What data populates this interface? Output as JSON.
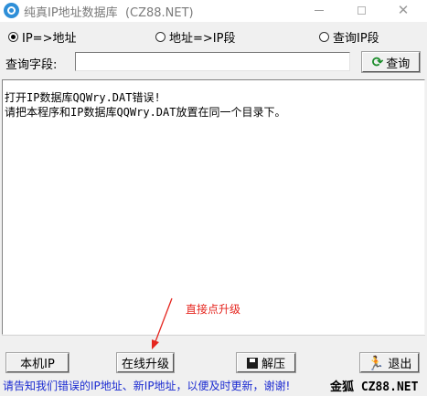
{
  "window": {
    "title": "纯真IP地址数据库  (CZ88.NET)",
    "icons": {
      "app": "app-logo-icon",
      "minimize": "minimize-icon",
      "maximize": "maximize-icon",
      "close": "close-icon"
    },
    "close_glyph": "✕"
  },
  "mode": {
    "options": [
      {
        "label": "IP=>地址",
        "selected": true
      },
      {
        "label": "地址=>IP段",
        "selected": false
      },
      {
        "label": "查询IP段",
        "selected": false
      }
    ]
  },
  "query": {
    "label": "查询字段:",
    "value": "",
    "button_label": "查询",
    "button_icon": "refresh-icon",
    "button_icon_glyph": "⟳"
  },
  "result": {
    "lines": [
      "打开IP数据库QQWry.DAT错误!",
      "请把本程序和IP数据库QQWry.DAT放置在同一个目录下。"
    ]
  },
  "annotation": {
    "text": "直接点升级",
    "color": "#e5261f"
  },
  "buttons": {
    "local_ip": "本机IP",
    "upgrade": "在线升级",
    "extract": "解压",
    "extract_icon": "save-disk-icon",
    "exit": "退出",
    "exit_icon": "running-man-icon",
    "exit_glyph": "🏃"
  },
  "status": {
    "message": "请告知我们错误的IP地址、新IP地址，以便及时更新，谢谢!",
    "brand": "金狐 CZ88.NET",
    "message_color": "#1a2ad1"
  }
}
